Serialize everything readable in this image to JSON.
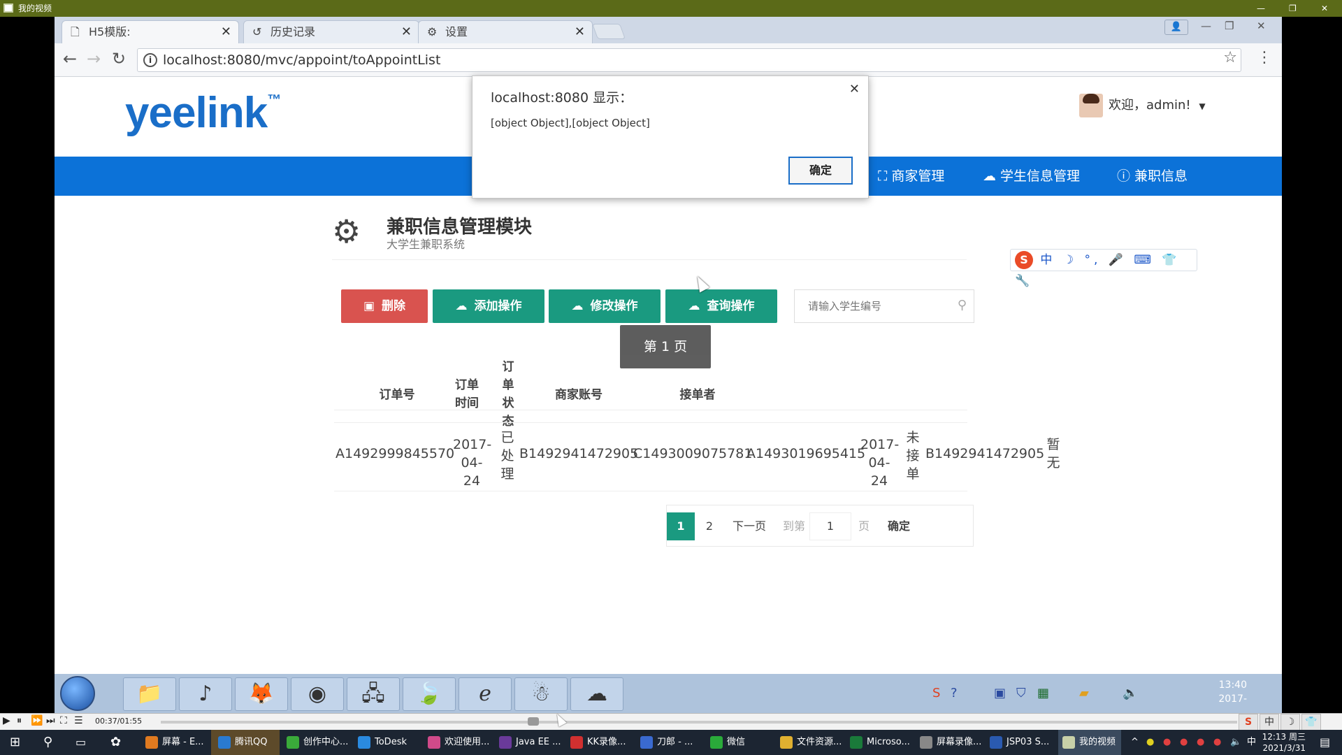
{
  "player": {
    "title": "我的视频",
    "time": "00:37/01:55"
  },
  "browser": {
    "tabs": [
      {
        "label": "H5模版:",
        "icon": "page-icon",
        "active": true
      },
      {
        "label": "历史记录",
        "icon": "history-icon",
        "active": false
      },
      {
        "label": "设置",
        "icon": "gear-icon",
        "active": false
      }
    ],
    "url": "localhost:8080/mvc/appoint/toAppointList"
  },
  "page": {
    "logo": "yeelink",
    "logo_tm": "™",
    "welcome": "欢迎，admin!",
    "nav": [
      {
        "label": "商家管理",
        "icon": "sitemap-icon"
      },
      {
        "label": "学生信息管理",
        "icon": "cloud-icon"
      },
      {
        "label": "兼职信息",
        "icon": "info-icon"
      }
    ],
    "module_title": "兼职信息管理模块",
    "module_subtitle": "大学生兼职系统",
    "buttons": {
      "delete": "删除",
      "add": "添加操作",
      "edit": "修改操作",
      "query": "查询操作"
    },
    "search_placeholder": "请输入学生编号",
    "table": {
      "headers": [
        "订单号",
        "订单时间",
        "订单状态",
        "商家账号",
        "接单者"
      ],
      "row": [
        "A1492999845570",
        "2017-04-24",
        "已处理",
        "B1492941472905",
        "C1493009075781",
        "A1493019695415",
        "2017-04-24",
        "未接单",
        "B1492941472905",
        "暂无"
      ]
    },
    "tooltip": "第 1 页",
    "pager": {
      "pages": [
        "1",
        "2"
      ],
      "current": "1",
      "next": "下一页",
      "goto": "到第",
      "goto_value": "1",
      "page_unit": "页",
      "confirm": "确定"
    }
  },
  "dialog": {
    "title": "localhost:8080 显示：",
    "message": "[object Object],[object Object]",
    "ok": "确定"
  },
  "inner_taskbar": {
    "clock_time": "13:40",
    "clock_date": "2017-"
  },
  "host_taskbar": {
    "items": [
      {
        "label": "屏幕 - E...",
        "color": "#e07a20"
      },
      {
        "label": "腾讯QQ",
        "color": "#2a7ad0"
      },
      {
        "label": "创作中心...",
        "color": "#3aaa3a"
      },
      {
        "label": "ToDesk",
        "color": "#2a8ae0"
      },
      {
        "label": "欢迎使用...",
        "color": "#d04a8a"
      },
      {
        "label": "Java EE ...",
        "color": "#6a3a9a"
      },
      {
        "label": "KK录像...",
        "color": "#d03030"
      },
      {
        "label": "刀郎 - ...",
        "color": "#3a6ad0"
      },
      {
        "label": "微信",
        "color": "#2aaa3a"
      },
      {
        "label": "文件资源...",
        "color": "#e0b030"
      },
      {
        "label": "Microso...",
        "color": "#1a7a3a"
      },
      {
        "label": "屏幕录像...",
        "color": "#888888"
      },
      {
        "label": "JSP03 S...",
        "color": "#2a5ab0"
      },
      {
        "label": "我的视频",
        "color": "#c8d0a8"
      }
    ],
    "time": "12:13 周三",
    "date": "2021/3/31"
  }
}
